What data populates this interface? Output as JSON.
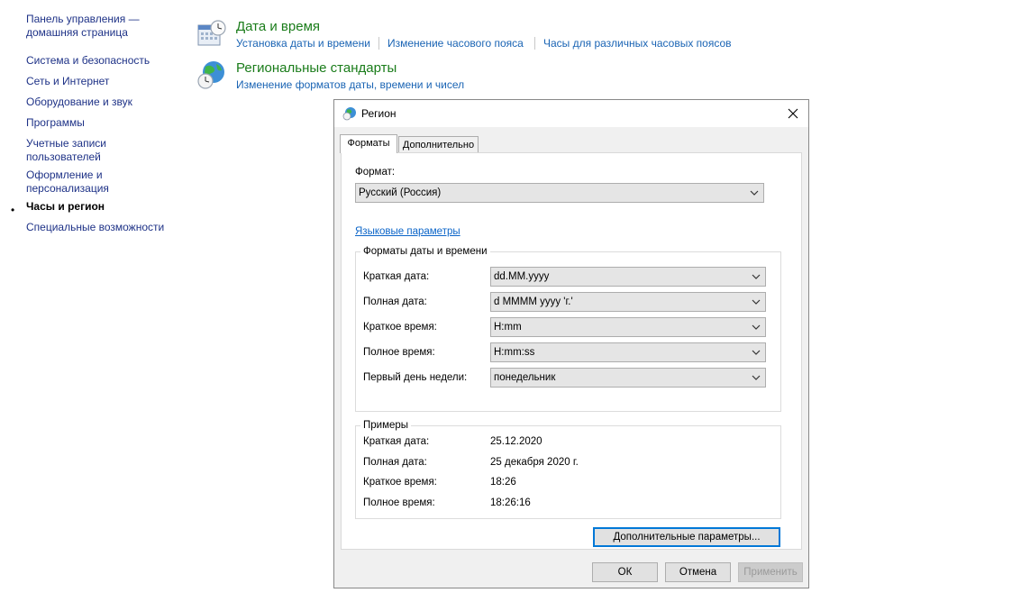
{
  "sidebar": {
    "home_link": "Панель управления — домашняя страница",
    "home_line1": "Панель управления —",
    "home_line2": "домашняя страница",
    "items": [
      {
        "label": "Система и безопасность"
      },
      {
        "label": "Сеть и Интернет"
      },
      {
        "label": "Оборудование и звук"
      },
      {
        "label": "Программы"
      },
      {
        "label_line1": "Учетные записи",
        "label_line2": "пользователей"
      },
      {
        "label_line1": "Оформление и",
        "label_line2": "персонализация"
      },
      {
        "label": "Часы и регион",
        "active": true
      },
      {
        "label": "Специальные возможности"
      }
    ]
  },
  "categories": [
    {
      "icon": "calendar-clock-icon",
      "title": "Дата и время",
      "links": [
        "Установка даты и времени",
        "Изменение часового пояса",
        "Часы для различных часовых поясов"
      ]
    },
    {
      "icon": "globe-clock-icon",
      "title": "Региональные стандарты",
      "links": [
        "Изменение форматов даты, времени и чисел"
      ]
    }
  ],
  "dialog": {
    "title": "Регион",
    "title_icon": "globe-icon",
    "close_icon": "close-icon",
    "tabs": [
      {
        "label": "Форматы",
        "active": true
      },
      {
        "label": "Дополнительно",
        "active": false
      }
    ],
    "format_label": "Формат:",
    "format_value": "Русский (Россия)",
    "language_link": "Языковые параметры",
    "date_time_group": {
      "legend": "Форматы даты и времени",
      "rows": [
        {
          "label": "Краткая дата:",
          "value": "dd.MM.yyyy"
        },
        {
          "label": "Полная дата:",
          "value": "d MMMM yyyy 'г.'"
        },
        {
          "label": "Краткое время:",
          "value": "H:mm"
        },
        {
          "label": "Полное время:",
          "value": "H:mm:ss"
        },
        {
          "label": "Первый день недели:",
          "value": "понедельник"
        }
      ]
    },
    "examples_group": {
      "legend": "Примеры",
      "rows": [
        {
          "label": "Краткая дата:",
          "value": "25.12.2020"
        },
        {
          "label": "Полная дата:",
          "value": "25 декабря 2020 г."
        },
        {
          "label": "Краткое время:",
          "value": "18:26"
        },
        {
          "label": "Полное время:",
          "value": "18:26:16"
        }
      ]
    },
    "additional_button": "Дополнительные параметры...",
    "ok_button": "ОК",
    "cancel_button": "Отмена",
    "apply_button": "Применить"
  },
  "colors": {
    "category_title": "#1a7c1a",
    "category_link": "#1a64b4",
    "sidebar_link": "#1e3287",
    "dialog_bg": "#f0f0f0",
    "focus_border": "#0078d7"
  }
}
